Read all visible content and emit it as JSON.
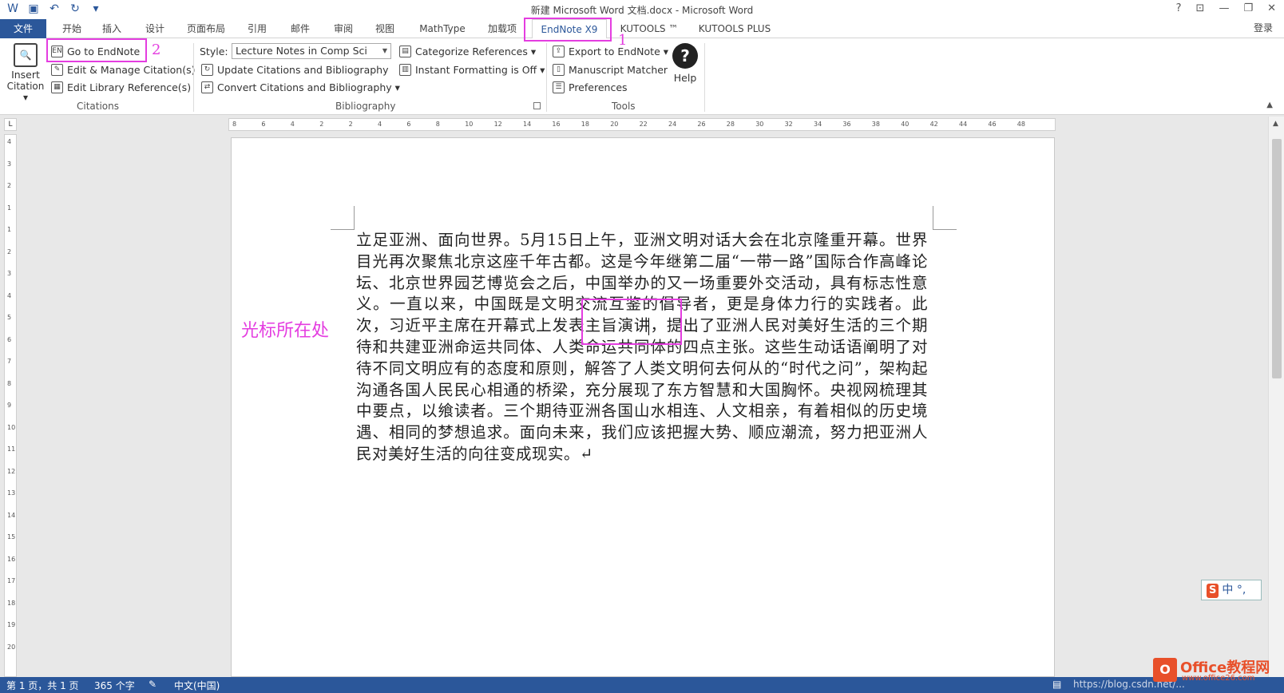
{
  "title": "新建 Microsoft Word 文档.docx - Microsoft Word",
  "window_controls": [
    "?",
    "⊡",
    "—",
    "❐",
    "✕"
  ],
  "login": "登录",
  "tabs": [
    "文件",
    "开始",
    "插入",
    "设计",
    "页面布局",
    "引用",
    "邮件",
    "审阅",
    "视图",
    "MathType",
    "加载项",
    "EndNote X9",
    "KUTOOLS ™",
    "KUTOOLS PLUS"
  ],
  "ribbon": {
    "insert_citation": [
      "Insert",
      "Citation ▾"
    ],
    "go_to_endnote": "Go to EndNote",
    "edit_manage": "Edit & Manage Citation(s)",
    "edit_library": "Edit Library Reference(s)",
    "citations_group": "Citations",
    "style_label": "Style:",
    "style_value": "Lecture Notes in Comp Sci",
    "update_citations": "Update Citations and Bibliography",
    "convert_citations": "Convert Citations and Bibliography ▾",
    "categorize": "Categorize References ▾",
    "instant_formatting": "Instant Formatting is Off ▾",
    "bibliography_group": "Bibliography",
    "export": "Export to EndNote ▾",
    "manuscript": "Manuscript Matcher",
    "preferences": "Preferences",
    "tools_group": "Tools",
    "help": "Help"
  },
  "annotations": {
    "num1": "1",
    "num2": "2",
    "cursor_label": "光标所在处"
  },
  "document": {
    "text": "立足亚洲、面向世界。5月15日上午，亚洲文明对话大会在北京隆重开幕。世界目光再次聚焦北京这座千年古都。这是今年继第二届“一带一路”国际合作高峰论坛、北京世界园艺博览会之后，中国举办的又一场重要外交活动，具有标志性意义。一直以来，中国既是文明交流互鉴的倡导者，更是身体力行的实践者。此次，习近平主席在开幕式上发表主旨演讲，提出了亚洲人民对美好生活的三个期待和共建亚洲命运共同体、人类命运共同体的四点主张。这些生动话语阐明了对待不同文明应有的态度和原则，解答了人类文明何去何从的“时代之问”，架构起沟通各国人民民心相通的桥梁，充分展现了东方智慧和大国胸怀。央视网梳理其中要点，以飨读者。三个期待亚洲各国山水相连、人文相亲，有着相似的历史境遇、相同的梦想追求。面向未来，我们应该把握大势、顺应潮流，努力把亚洲人民对美好生活的向往变成现实。↵"
  },
  "hruler_ticks": [
    "8",
    "6",
    "4",
    "2",
    "2",
    "4",
    "6",
    "8",
    "10",
    "12",
    "14",
    "16",
    "18",
    "20",
    "22",
    "24",
    "26",
    "28",
    "30",
    "32",
    "34",
    "36",
    "38",
    "40",
    "42",
    "44",
    "46",
    "48"
  ],
  "vruler_ticks": [
    "4",
    "3",
    "2",
    "1",
    "1",
    "2",
    "3",
    "4",
    "5",
    "6",
    "7",
    "8",
    "9",
    "10",
    "11",
    "12",
    "13",
    "14",
    "15",
    "16",
    "17",
    "18",
    "19",
    "20"
  ],
  "status": {
    "page": "第 1 页，共 1 页",
    "words": "365 个字",
    "language": "中文(中国)",
    "url": "https://blog.csdn.net/..."
  },
  "ime": {
    "logo": "S",
    "text": "中 °,"
  },
  "watermark": {
    "text": "Office教程网",
    "sub": "www.office26.com"
  },
  "colors": {
    "accent": "#2b579a",
    "highlight": "#e43de0"
  }
}
